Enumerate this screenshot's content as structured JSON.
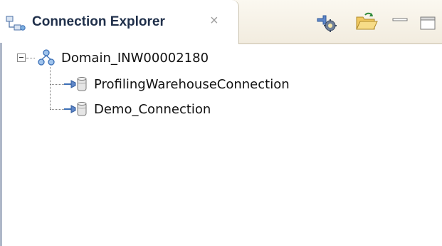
{
  "view": {
    "tab_title": "Connection Explorer",
    "tab_close_glyph": "×",
    "tab_icon": "connection-explorer-icon",
    "toolbar": [
      {
        "icon": "connection-settings-icon"
      },
      {
        "icon": "open-folder-icon"
      },
      {
        "icon": "minimize-icon"
      },
      {
        "icon": "maximize-icon"
      }
    ]
  },
  "tree": {
    "root": {
      "label": "Domain_INW00002180",
      "icon": "domain-icon",
      "expanded": true
    },
    "children": [
      {
        "label": "ProfilingWarehouseConnection",
        "icon": "database-connection-icon"
      },
      {
        "label": "Demo_Connection",
        "icon": "database-connection-icon"
      }
    ]
  },
  "colors": {
    "tab_bar_bg": "#f2ecdf",
    "title_text": "#1f2f4a",
    "accent_blue": "#3b6fb6"
  }
}
